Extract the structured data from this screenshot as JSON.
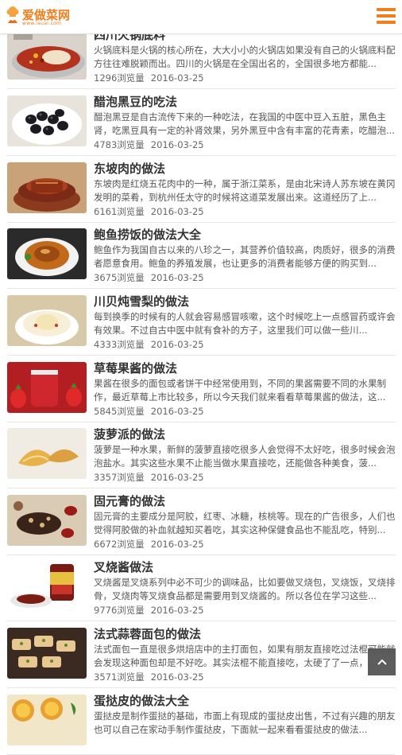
{
  "header": {
    "logo_title": "爱做菜网",
    "logo_url": "www.iauai.com",
    "menu_icon": "hamburger-menu-icon",
    "accent": "#f07f1e"
  },
  "recipes": [
    {
      "title": "四川火锅底料",
      "desc": "火锅底料是火锅的核心所在，大大小小的火锅店如果没有自己的火锅底料配方往往难脱颖而出。四川的火锅是在全国出名的，全国很多地方都能...",
      "views": "1296浏览量",
      "date": "2016-03-25"
    },
    {
      "title": "醋泡黑豆的吃法",
      "desc": "醋泡黑豆是自古流传下来的一种吃法，在我国的中医中豆入五脏，黑色主肾，吃黑豆具有一定的补肾效果，另外黑豆中含有丰富的花青素，吃醋泡...",
      "views": "4783浏览量",
      "date": "2016-03-25"
    },
    {
      "title": "东坡肉的做法",
      "desc": "东坡肉是红烧五花肉中的一种，属于浙江菜系，是由北宋诗人苏东坡在黄冈发明的菜肴，到杭州任太守的时候将这道菜发展出来。这道经历了上...",
      "views": "6161浏览量",
      "date": "2016-03-25"
    },
    {
      "title": "鲍鱼捞饭的做法大全",
      "desc": "鲍鱼作为我国自古以来的八珍之一，其营养价值较高，肉质好，很多的消费者愿意食用。鲍鱼的养殖发展，也让更多的消费者能够方便的购买到...",
      "views": "3675浏览量",
      "date": "2016-03-25"
    },
    {
      "title": "川贝炖雪梨的做法",
      "desc": "每到换季的时候有的人就会容易感冒咳嗽，这个时候吃上一点感冒药或许会有效果。不过自古中医中就有食补的方子，这里我们可以做一些川...",
      "views": "4333浏览量",
      "date": "2016-03-25"
    },
    {
      "title": "草莓果酱的做法",
      "desc": "果酱在很多的面包或者饼干中经常使用到，不同的果酱需要不同的水果制作，最近草莓上市比较多，所以今天我们就来看看草莓果酱的做法，这...",
      "views": "5845浏览量",
      "date": "2016-03-25"
    },
    {
      "title": "菠萝派的做法",
      "desc": "菠萝是一种水果，新鲜的菠萝直接吃很多人会觉得不太好吃，很多时候会泡泡盐水。其实这些水果不止能当做水果直接吃，还能做各种美食，菠...",
      "views": "3357浏览量",
      "date": "2016-03-25"
    },
    {
      "title": "固元膏的做法",
      "desc": "固元膏的主要成分是阿胶，红枣、冰糖，核桃等。现在的广告很多，人们也觉得阿胶做的补血就越知买着吃，其实这种保健食品也不能乱吃，特别...",
      "views": "6672浏览量",
      "date": "2016-03-25"
    },
    {
      "title": "叉烧酱做法",
      "desc": "叉烧酱是叉烧系列中必不可少的调味品，比如要做叉烧包，叉烧饭，叉烧排骨，叉烧肉等叉烧食品都是需要用到叉烧酱的。所以各位在学习这些...",
      "views": "9776浏览量",
      "date": "2016-03-25"
    },
    {
      "title": "法式蒜蓉面包的做法",
      "desc": "法式面包一直是很多烘焙店中的主打面包，如果有朋友直接吃过法棍可能就会发现这种面包却是不好吃。其实法棍不能直接吃，太硬了了一点，...",
      "views": "3571浏览量",
      "date": "2016-03-25"
    },
    {
      "title": "蛋挞皮的做法大全",
      "desc": "蛋挞皮是制作蛋挞的基础，市面上有现成的蛋挞皮出售，不过有兴趣的朋友也可以自己在家动手制作蛋挞皮，下面就一起来看看蛋挞皮的做法...",
      "views": "",
      "date": ""
    }
  ],
  "scroll_top_icon": "chevron-up-icon"
}
